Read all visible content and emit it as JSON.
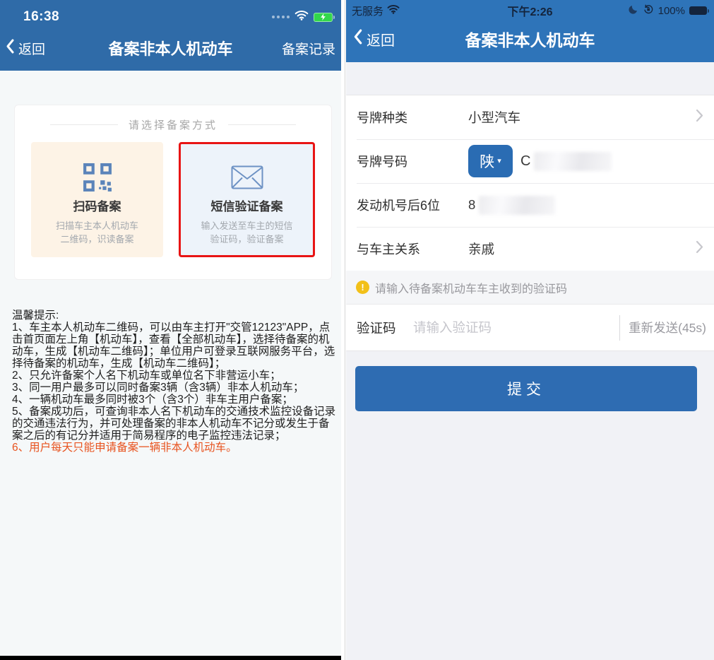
{
  "colors": {
    "left_nav_blue": "#2F6BA8",
    "right_nav_blue": "#2E74B9",
    "option_scan_bg": "#FDF3E6",
    "option_sms_bg": "#EDF3FA",
    "selected_border_red": "#E81414",
    "icon_blue": "#5B84BA",
    "tip_highlight_orange": "#E8531F",
    "province_button_blue": "#2A6CB3",
    "submit_blue": "#2E6CB2",
    "warning_yellow": "#F2C019",
    "battery_green": "#32D74B"
  },
  "icons": {
    "dropdown_arrow": "▾",
    "warning_mark": "!"
  },
  "left": {
    "status": {
      "time": "16:38"
    },
    "nav": {
      "back_label": "返回",
      "title": "备案非本人机动车",
      "records_label": "备案记录"
    },
    "card": {
      "title": "请选择备案方式",
      "options": [
        {
          "title": "扫码备案",
          "desc_line1": "扫描车主本人机动车",
          "desc_line2": "二维码，识读备案",
          "icon": "qr-code",
          "selected": false
        },
        {
          "title": "短信验证备案",
          "desc_line1": "输入发送至车主的短信",
          "desc_line2": "验证码，验证备案",
          "icon": "envelope",
          "selected": true
        }
      ]
    },
    "tips": {
      "heading": "温馨提示:",
      "items": [
        "1、车主本人机动车二维码，可以由车主打开\"交管12123\"APP，点击首页面左上角【机动车】，查看【全部机动车】，选择待备案的机动车，生成【机动车二维码】；单位用户可登录互联网服务平台，选择待备案的机动车，生成【机动车二维码】；",
        "2、只允许备案个人名下机动车或单位名下非营运小车；",
        "3、同一用户最多可以同时备案3辆（含3辆）非本人机动车；",
        "4、一辆机动车最多同时被3个（含3个）非车主用户备案；",
        "5、备案成功后，可查询非本人名下机动车的交通技术监控设备记录的交通违法行为，并可处理备案的非本人机动车不记分或发生于备案之后的有记分并适用于简易程序的电子监控违法记录；",
        "6、用户每天只能申请备案一辆非本人机动车。"
      ]
    }
  },
  "right": {
    "status": {
      "carrier": "无服务",
      "time": "下午2:26",
      "battery_percent": "100%"
    },
    "nav": {
      "back_label": "返回",
      "title": "备案非本人机动车"
    },
    "form": {
      "rows": [
        {
          "label": "号牌种类",
          "value": "小型汽车"
        },
        {
          "label": "号牌号码",
          "province": "陕",
          "value_visible": "C",
          "masked": true
        },
        {
          "label": "发动机号后6位",
          "value_visible": "8",
          "masked": true
        },
        {
          "label": "与车主关系",
          "value": "亲戚"
        }
      ]
    },
    "warning_text": "请输入待备案机动车车主收到的验证码",
    "code_row": {
      "label": "验证码",
      "placeholder": "请输入验证码",
      "resend_label": "重新发送(45s)"
    },
    "submit_label": "提交"
  }
}
